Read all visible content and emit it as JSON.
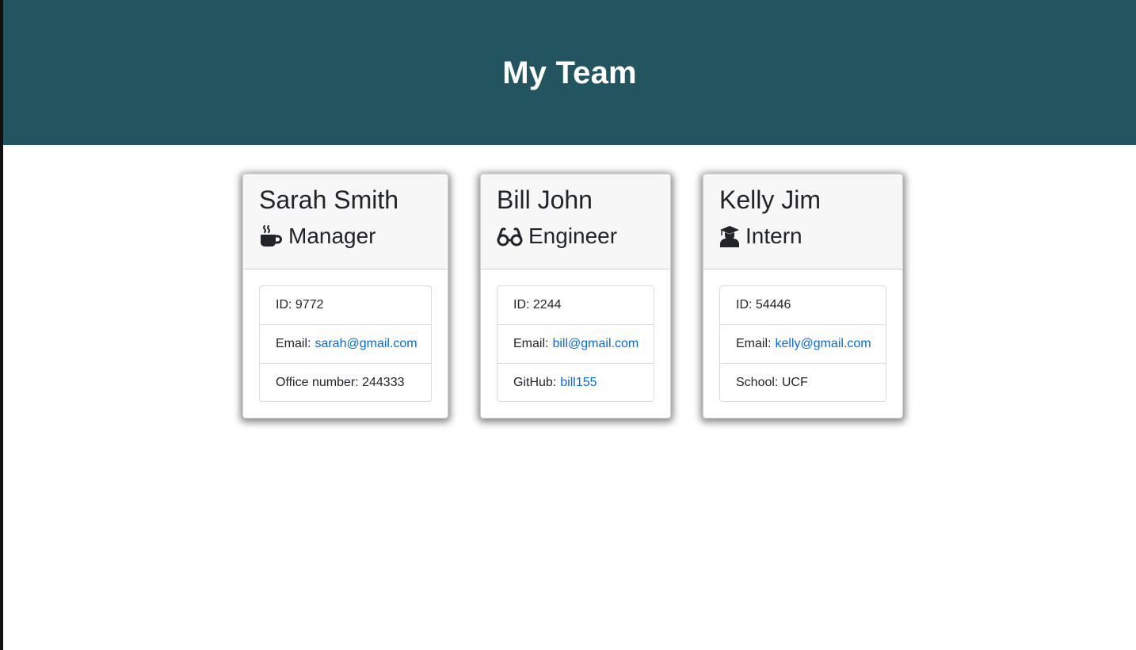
{
  "header": {
    "title": "My Team"
  },
  "team": [
    {
      "name": "Sarah Smith",
      "role": "Manager",
      "icon": "mug-hot-icon",
      "id_label": "ID:",
      "id": "9772",
      "email_label": "Email:",
      "email": "sarah@gmail.com",
      "extra_label": "Office number:",
      "extra_value": "244333"
    },
    {
      "name": "Bill John",
      "role": "Engineer",
      "icon": "glasses-icon",
      "id_label": "ID:",
      "id": "2244",
      "email_label": "Email:",
      "email": "bill@gmail.com",
      "extra_label": "GitHub:",
      "extra_value": "bill155"
    },
    {
      "name": "Kelly Jim",
      "role": "Intern",
      "icon": "user-graduate-icon",
      "id_label": "ID:",
      "id": "54446",
      "email_label": "Email:",
      "email": "kelly@gmail.com",
      "extra_label": "School:",
      "extra_value": "UCF"
    }
  ],
  "colors": {
    "header_bg": "#225560",
    "link": "#0a6ae0",
    "card_header_bg": "#f7f7f7"
  }
}
